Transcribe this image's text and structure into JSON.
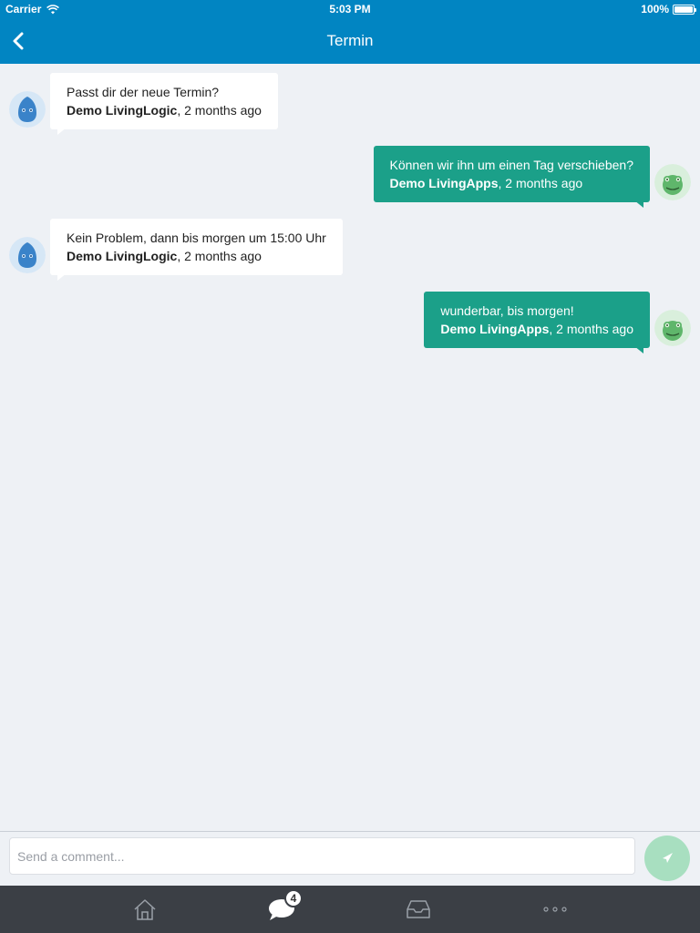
{
  "status_bar": {
    "carrier": "Carrier",
    "time": "5:03 PM",
    "battery": "100%"
  },
  "nav": {
    "title": "Termin",
    "back_icon": "chevron-left-icon"
  },
  "messages": [
    {
      "direction": "incoming",
      "text": "Passt dir der neue Termin?",
      "author": "Demo LivingLogic",
      "time": ", 2 months ago",
      "avatar_color": "#3a83c9"
    },
    {
      "direction": "outgoing",
      "text": "Können wir ihn um einen Tag verschieben?",
      "author": "Demo LivingApps",
      "time": ", 2 months ago",
      "avatar_color": "#5fb66b"
    },
    {
      "direction": "incoming",
      "text": "Kein Problem, dann bis morgen um 15:00 Uhr",
      "author": "Demo LivingLogic",
      "time": ", 2 months ago",
      "avatar_color": "#3a83c9"
    },
    {
      "direction": "outgoing",
      "text": "wunderbar, bis morgen!",
      "author": "Demo LivingApps",
      "time": ", 2 months ago",
      "avatar_color": "#5fb66b"
    }
  ],
  "composer": {
    "placeholder": "Send a comment...",
    "send_icon": "send-icon"
  },
  "tabbar": {
    "tabs": [
      {
        "name": "home",
        "icon": "home-icon"
      },
      {
        "name": "messages",
        "icon": "chat-bubble-icon",
        "badge": "4"
      },
      {
        "name": "inbox",
        "icon": "inbox-icon"
      },
      {
        "name": "more",
        "icon": "more-dots-icon"
      }
    ]
  },
  "colors": {
    "header": "#0185c2",
    "outgoing_bubble": "#1ba089",
    "incoming_bubble": "#ffffff",
    "tabbar": "#3b3f45",
    "send_button": "#a8dfc0"
  }
}
